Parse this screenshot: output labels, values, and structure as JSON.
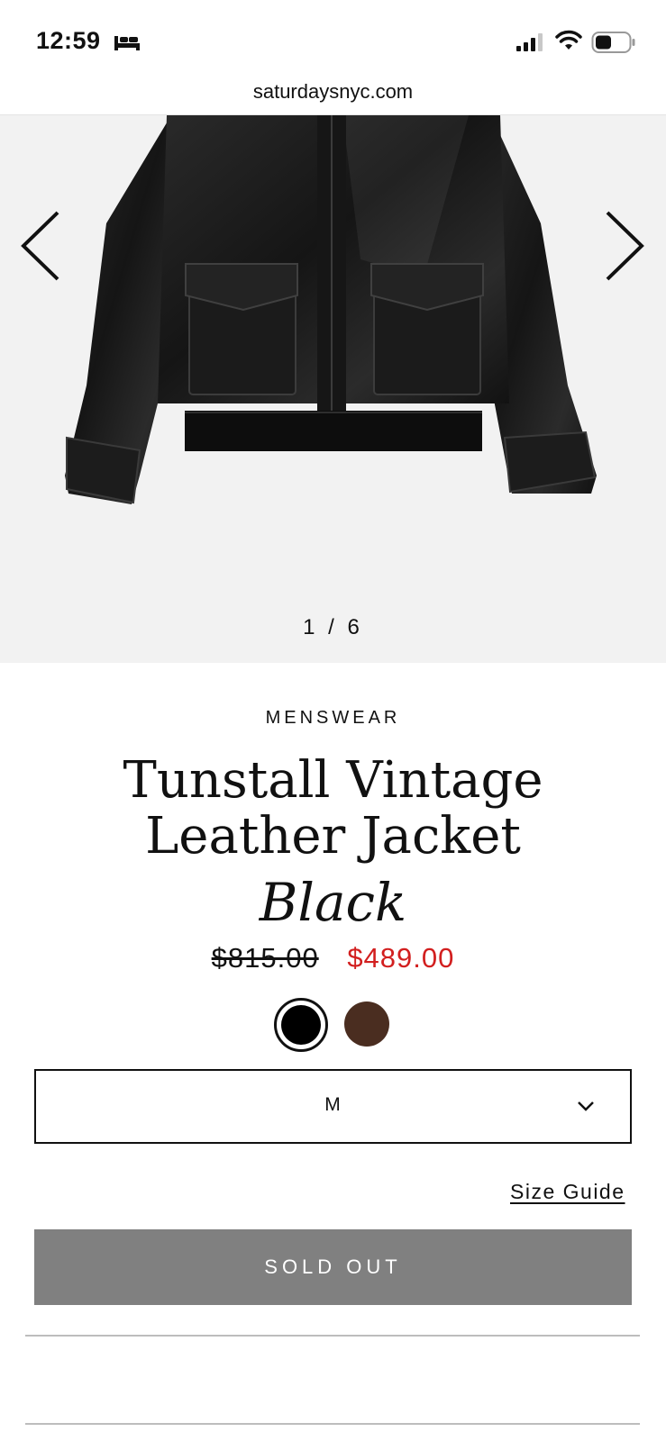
{
  "status_bar": {
    "time": "12:59"
  },
  "browser": {
    "url": "saturdaysnyc.com"
  },
  "gallery": {
    "counter": "1 / 6",
    "prev_icon": "chevron-left-icon",
    "next_icon": "chevron-right-icon"
  },
  "product": {
    "category": "MENSWEAR",
    "title_line1": "Tunstall Vintage",
    "title_line2": "Leather Jacket",
    "color_name": "Black",
    "price_original": "$815.00",
    "price_sale": "$489.00",
    "swatches": [
      {
        "color": "#000000",
        "selected": true
      },
      {
        "color": "#4a2d20",
        "selected": false
      }
    ],
    "size_selected": "M",
    "size_guide_label": "Size Guide",
    "cta_label": "SOLD OUT"
  },
  "colors": {
    "sale_price": "#d21f1f",
    "sold_out_bg": "#808080"
  }
}
